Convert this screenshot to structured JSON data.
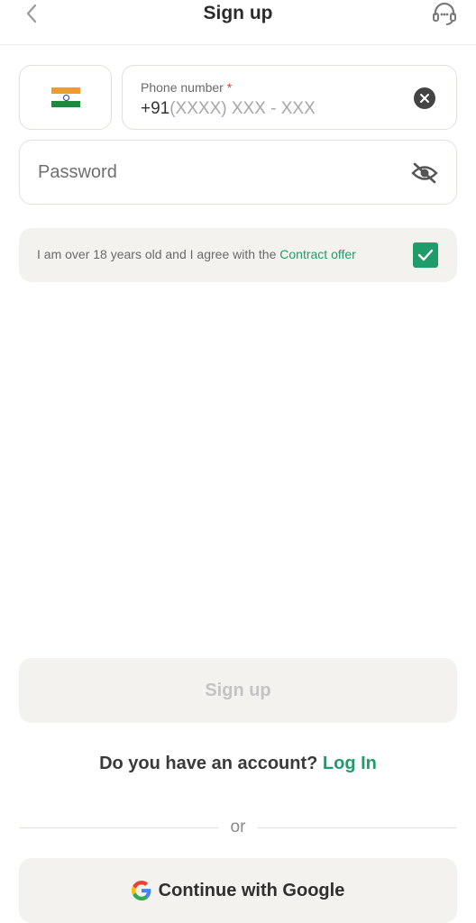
{
  "header": {
    "title": "Sign up",
    "back_icon": "chevron-left-icon",
    "support_icon": "headset-icon"
  },
  "phone": {
    "country_icon": "india-flag-icon",
    "label": "Phone number",
    "required_mark": "*",
    "prefix": "+91",
    "placeholder": "(XXXX) XXX - XXX",
    "clear_icon": "clear-icon"
  },
  "password": {
    "placeholder": "Password",
    "toggle_icon": "eye-off-icon"
  },
  "consent": {
    "text": "I am over 18 years old and I agree with the ",
    "link": "Contract offer",
    "checked": true
  },
  "actions": {
    "signup_label": "Sign up",
    "account_prompt": "Do you have an account?",
    "login_label": "Log In",
    "or_label": "or",
    "google_label": "Continue with Google"
  },
  "colors": {
    "accent": "#1f9c6a",
    "surface": "#f4f2ee",
    "border": "#e3e0d8",
    "required": "#e0403a"
  }
}
